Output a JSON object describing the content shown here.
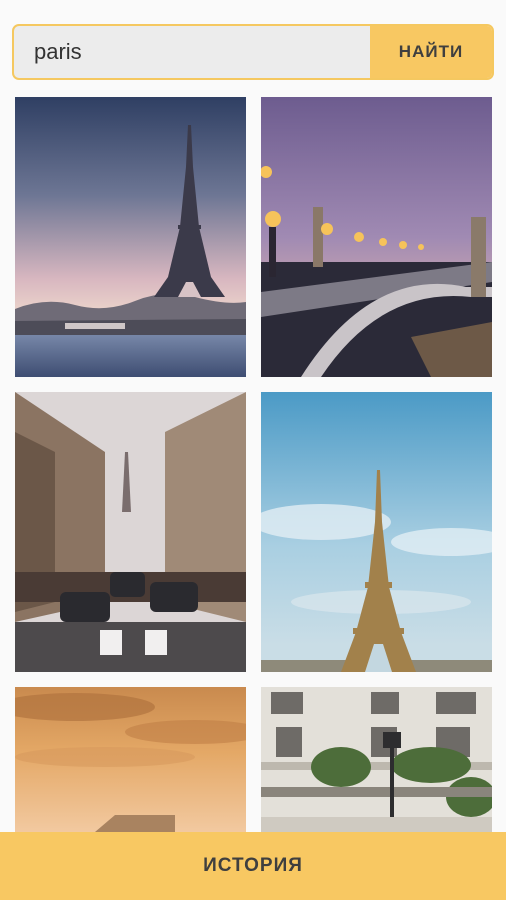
{
  "search": {
    "query": "paris",
    "button_label": "НАЙТИ"
  },
  "results": [
    {
      "name": "eiffel-tower-dusk-river"
    },
    {
      "name": "pont-alexandre-iii-bridge"
    },
    {
      "name": "paris-street-eiffel-view"
    },
    {
      "name": "eiffel-tower-blue-sky"
    },
    {
      "name": "sunset-cloudy-sky"
    },
    {
      "name": "parisian-building-facade"
    }
  ],
  "footer": {
    "history_label": "ИСТОРИЯ"
  },
  "colors": {
    "accent": "#f8c862",
    "background": "#fafafa"
  }
}
